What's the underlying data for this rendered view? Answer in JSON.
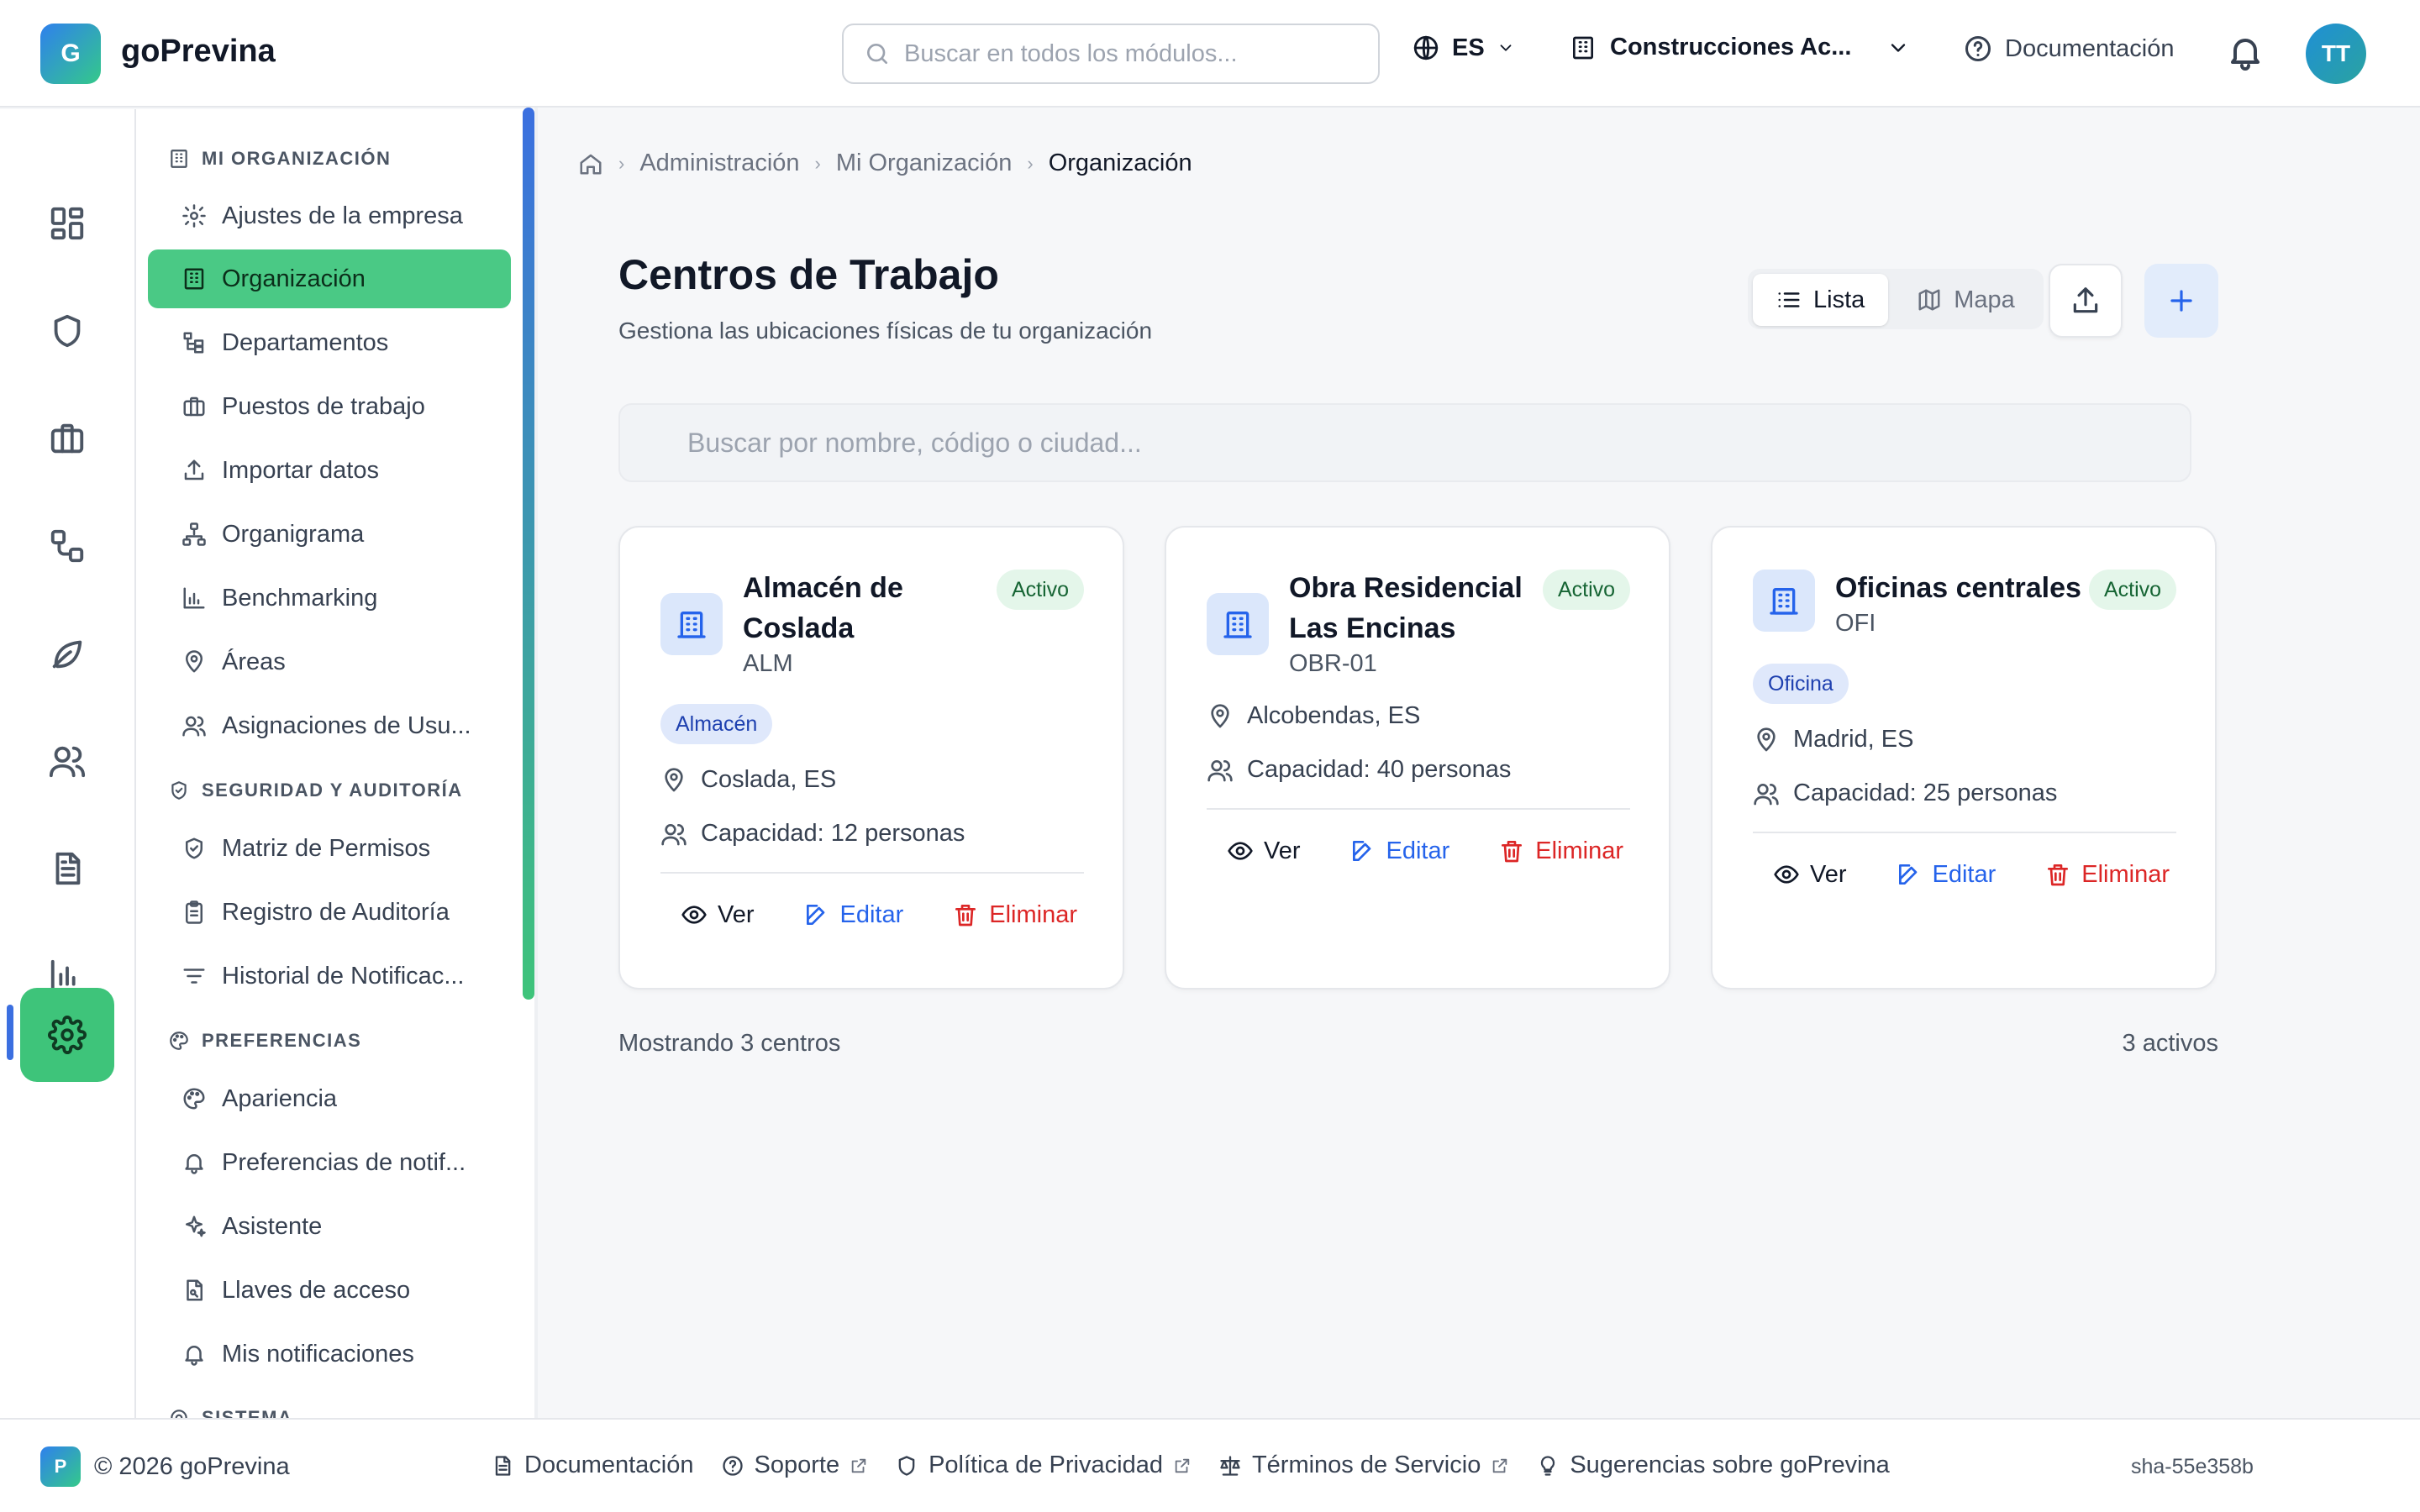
{
  "app": {
    "logo_letter": "G",
    "name": "goPrevina"
  },
  "header": {
    "search_placeholder": "Buscar en todos los módulos...",
    "language": "ES",
    "company": "Construcciones Ac...",
    "docs_label": "Documentación",
    "avatar_initials": "TT"
  },
  "rail": {
    "items": [
      "dashboard-icon",
      "shield-icon",
      "briefcase-icon",
      "workflow-icon",
      "leaf-icon",
      "users-icon",
      "document-icon",
      "chart-icon",
      "gear-icon"
    ],
    "active": "gear-icon"
  },
  "submenu": {
    "sections": [
      {
        "title": "MI ORGANIZACIÓN",
        "items": [
          "Ajustes de la empresa",
          "Organización",
          "Departamentos",
          "Puestos de trabajo",
          "Importar datos",
          "Organigrama",
          "Benchmarking",
          "Áreas",
          "Asignaciones de Usu..."
        ]
      },
      {
        "title": "SEGURIDAD Y AUDITORÍA",
        "items": [
          "Matriz de Permisos",
          "Registro de Auditoría",
          "Historial de Notificac..."
        ]
      },
      {
        "title": "PREFERENCIAS",
        "items": [
          "Apariencia",
          "Preferencias de notif...",
          "Asistente",
          "Llaves de acceso",
          "Mis notificaciones"
        ]
      },
      {
        "title": "SISTEMA",
        "items": []
      }
    ],
    "active_item": "Organización"
  },
  "breadcrumb": [
    "Administración",
    "Mi Organización",
    "Organización"
  ],
  "page": {
    "title": "Centros de Trabajo",
    "subtitle": "Gestiona las ubicaciones físicas de tu organización",
    "view_list": "Lista",
    "view_map": "Mapa",
    "search_placeholder": "Buscar por nombre, código o ciudad..."
  },
  "centers": [
    {
      "name": "Almacén de Coslada",
      "code": "ALM",
      "status": "Activo",
      "type": "Almacén",
      "location": "Coslada, ES",
      "capacity": "Capacidad: 12 personas"
    },
    {
      "name": "Obra Residencial Las Encinas",
      "code": "OBR-01",
      "status": "Activo",
      "type": "",
      "location": "Alcobendas, ES",
      "capacity": "Capacidad: 40 personas"
    },
    {
      "name": "Oficinas centrales",
      "code": "OFI",
      "status": "Activo",
      "type": "Oficina",
      "location": "Madrid, ES",
      "capacity": "Capacidad: 25 personas"
    }
  ],
  "actions": {
    "view": "Ver",
    "edit": "Editar",
    "delete": "Eliminar"
  },
  "summary": {
    "count": "Mostrando 3 centros",
    "active": "3 activos"
  },
  "footer": {
    "logo_letter": "P",
    "copyright": "© 2026 goPrevina",
    "links": [
      "Documentación",
      "Soporte",
      "Política de Privacidad",
      "Términos de Servicio",
      "Sugerencias sobre goPrevina"
    ],
    "sha": "sha-55e358b"
  },
  "colors": {
    "accent_green": "#4ac985",
    "accent_blue": "#2563eb",
    "danger": "#dc2626",
    "status_bg": "#e4f6ea"
  }
}
